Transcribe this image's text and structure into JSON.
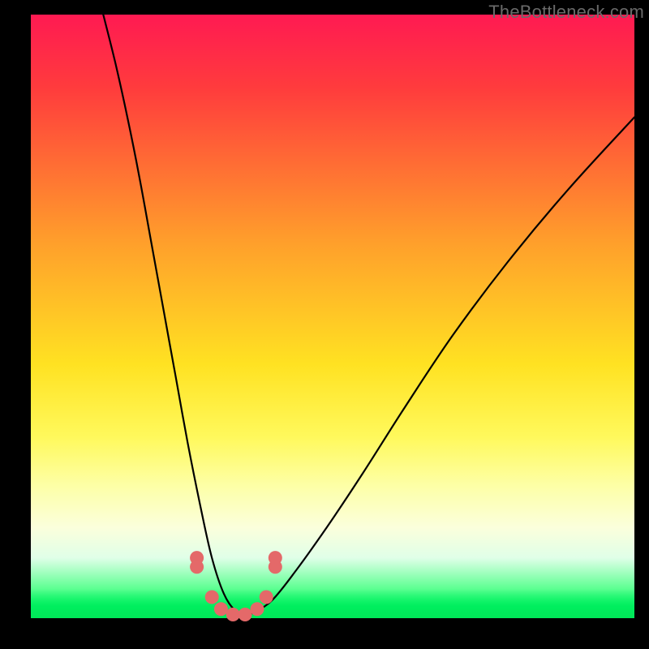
{
  "watermark": "TheBottleneck.com",
  "colors": {
    "frame": "#000000",
    "curve_stroke": "#000000",
    "marker_fill": "#e46969",
    "gradient_stops": [
      "#ff1a52",
      "#ff3b3d",
      "#ffa02b",
      "#ffe222",
      "#fff95c",
      "#fdffa6",
      "#fbffdc",
      "#e0ffe8",
      "#5fff93",
      "#00ff66"
    ]
  },
  "chart_data": {
    "type": "line",
    "title": "",
    "xlabel": "",
    "ylabel": "",
    "xlim": [
      0,
      100
    ],
    "ylim": [
      0,
      100
    ],
    "grid": false,
    "legend": false,
    "series": [
      {
        "name": "left-curve",
        "x": [
          12,
          14,
          16,
          18,
          20,
          22,
          24,
          26,
          28,
          30,
          32,
          34,
          35
        ],
        "y": [
          100,
          92,
          83,
          73,
          62,
          51,
          40,
          29,
          19,
          10,
          4,
          1,
          0
        ]
      },
      {
        "name": "right-curve",
        "x": [
          35,
          37,
          40,
          44,
          49,
          55,
          62,
          70,
          79,
          89,
          100
        ],
        "y": [
          0,
          1,
          3,
          8,
          15,
          24,
          35,
          47,
          59,
          71,
          83
        ]
      },
      {
        "name": "markers",
        "type": "scatter",
        "x": [
          27.5,
          27.5,
          30,
          31.5,
          33.5,
          35.5,
          37.5,
          39,
          40.5,
          40.5
        ],
        "y": [
          10,
          8.5,
          3.5,
          1.5,
          0.6,
          0.6,
          1.5,
          3.5,
          8.5,
          10
        ]
      }
    ]
  }
}
